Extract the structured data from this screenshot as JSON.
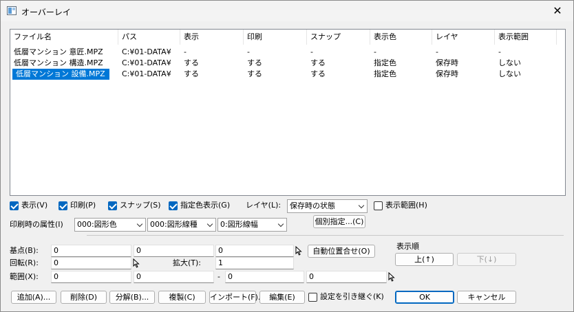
{
  "window": {
    "title": "オーバーレイ",
    "close_glyph": "✕"
  },
  "listview": {
    "columns": [
      "ファイル名",
      "パス",
      "表示",
      "印刷",
      "スナップ",
      "表示色",
      "レイヤ",
      "表示範囲"
    ],
    "rows": [
      [
        "低層マンション 意匠.MPZ",
        "C:¥01-DATA¥",
        "-",
        "-",
        "-",
        "-",
        "-",
        "-"
      ],
      [
        "低層マンション 構造.MPZ",
        "C:¥01-DATA¥",
        "する",
        "する",
        "する",
        "指定色",
        "保存時",
        "しない"
      ],
      [
        "低層マンション 設備.MPZ",
        "C:¥01-DATA¥",
        "する",
        "する",
        "する",
        "指定色",
        "保存時",
        "しない"
      ]
    ],
    "selected_row": 2
  },
  "options": {
    "show": "表示(V)",
    "print": "印刷(P)",
    "snap": "スナップ(S)",
    "color": "指定色表示(G)",
    "layer_label": "レイヤ(L):",
    "layer_value": "保存時の状態",
    "range": "表示範囲(H)"
  },
  "print_attr": {
    "label": "印刷時の属性(I)",
    "shape_color": "000:図形色",
    "line_type": "000:図形線種",
    "line_width": "0:図形線幅",
    "individual_button": "個別指定...(C)"
  },
  "transform": {
    "base_label": "基点(B):",
    "base_x": "0",
    "base_y": "0",
    "base_z": "0",
    "auto_position_button": "自動位置合せ(O)",
    "rotate_label": "回転(R):",
    "rotate_value": "0",
    "scale_label": "拡大(T):",
    "scale_value": "1",
    "range_label": "範囲(X):",
    "range_x1": "0",
    "range_y1": "0",
    "range_dash": "-",
    "range_x2": "0",
    "range_y2": "0"
  },
  "order": {
    "label": "表示順",
    "up_button": "上(↑)",
    "down_button": "下(↓)"
  },
  "footer": {
    "add": "追加(A)...",
    "delete": "削除(D)",
    "decompose": "分解(B)...",
    "duplicate": "複製(C)",
    "import": "インポート(F)...",
    "edit": "編集(E)",
    "inherit": "設定を引き継ぐ(K)",
    "ok": "OK",
    "cancel": "キャンセル"
  }
}
